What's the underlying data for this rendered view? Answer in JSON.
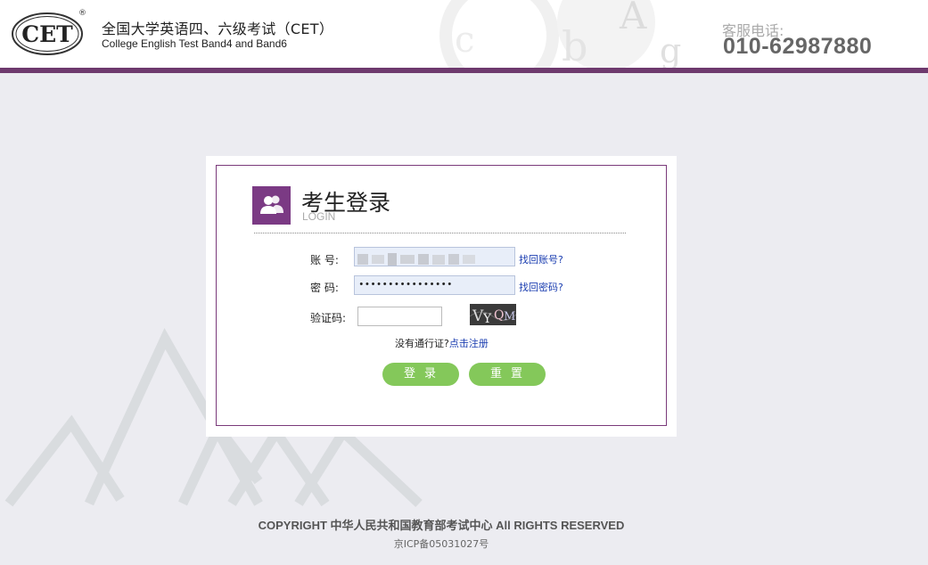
{
  "header": {
    "logo_text": "CET",
    "logo_reg": "®",
    "title_cn": "全国大学英语四、六级考试（CET）",
    "title_en": "College English Test Band4 and Band6",
    "phone_label": "客服电话:",
    "phone_number": "010-62987880",
    "accent_color": "#6e3a6e"
  },
  "login": {
    "title": "考生登录",
    "subtitle": "LOGIN",
    "account_label": "账  号:",
    "account_value": "",
    "password_label": "密  码:",
    "password_value": "••••••••••••••••",
    "captcha_label": "验证码:",
    "captcha_value": "",
    "captcha_image_text": "VYQM",
    "find_account_link": "找回账号?",
    "find_password_link": "找回密码?",
    "no_pass_text": "没有通行证?",
    "register_link": "点击注册",
    "login_button": "登录",
    "reset_button": "重置",
    "button_color": "#84c85a"
  },
  "footer": {
    "copyright": "COPYRIGHT 中华人民共和国教育部考试中心 All RIGHTS RESERVED",
    "icp": "京ICP备05031027号"
  }
}
